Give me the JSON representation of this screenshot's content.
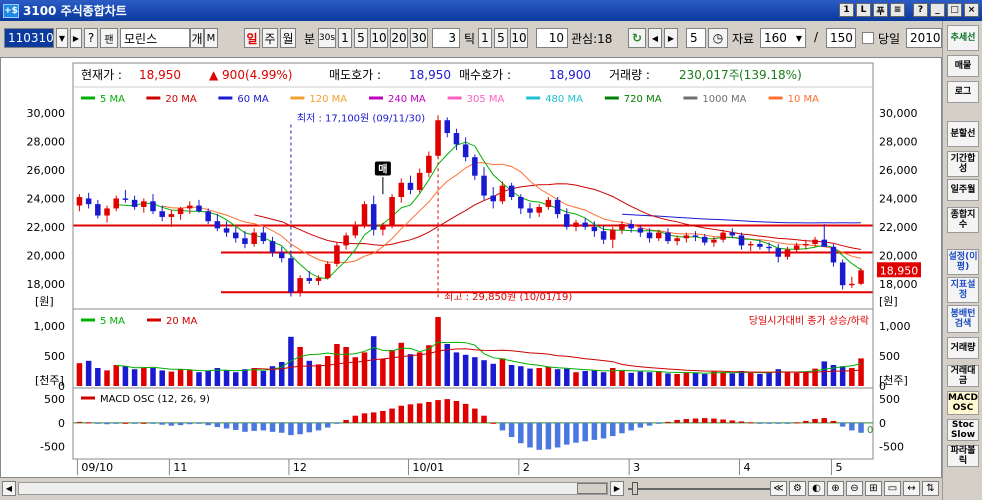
{
  "window": {
    "title": "3100 주식종합차트",
    "icon_label": "+$"
  },
  "title_buttons": [
    "1",
    "L",
    "푸",
    "≡",
    "?",
    "_",
    "□",
    "×"
  ],
  "toolbar": {
    "code": "110310",
    "name": "모린스",
    "period_buttons": [
      "일",
      "주",
      "월"
    ],
    "minute_label": "분",
    "minute_buttons": [
      "30s",
      "1",
      "5",
      "10",
      "20",
      "30"
    ],
    "minute_value": "3",
    "tick_label": "틱",
    "tick_buttons": [
      "1",
      "5",
      "10"
    ],
    "tick_value": "10",
    "watch_label": "관심:18",
    "step_value": "5",
    "data_label": "자료",
    "data_count": "160",
    "slash": "/",
    "total": "150",
    "today_label": "당일",
    "date_value": "2010-",
    "code_btns": [
      "?",
      "팬"
    ],
    "name_btns": [
      "개",
      "M"
    ]
  },
  "right_panel": {
    "items": [
      "추세선",
      "매물",
      "로그",
      "분할선",
      "기간합성",
      "일주월",
      "종합지수",
      "설정(이평)",
      "지표설정",
      "봉배턴검색",
      "거래량",
      "거래대금",
      "MACD OSC",
      "Stoc Slow",
      "파라볼릭"
    ]
  },
  "info": {
    "price_label": "현재가 :",
    "price": "18,950",
    "change": "▲ 900(4.99%)",
    "ask_label": "매도호가 :",
    "ask": "18,950",
    "bid_label": "매수호가 :",
    "bid": "18,900",
    "volume_label": "거래량 :",
    "volume": "230,017주",
    "volume_ratio": "(139.18%)"
  },
  "legend": [
    {
      "label": "5 MA",
      "color": "#00b000"
    },
    {
      "label": "20 MA",
      "color": "#d00000"
    },
    {
      "label": "60 MA",
      "color": "#1a1ad0"
    },
    {
      "label": "120 MA",
      "color": "#f0a030"
    },
    {
      "label": "240 MA",
      "color": "#c000c0"
    },
    {
      "label": "305 MA",
      "color": "#ff60c0"
    },
    {
      "label": "480 MA",
      "color": "#20c0d0"
    },
    {
      "label": "720 MA",
      "color": "#008000"
    },
    {
      "label": "1000 MA",
      "color": "#707070"
    },
    {
      "label": "10 MA",
      "color": "#ff7030"
    }
  ],
  "price_annotations": {
    "low_label": "최저 : 17,100원 (09/11/30)",
    "high_label": "최고 : 29,850원 (10/01/19)",
    "buy_marker": "매",
    "current_price_tag": "18,950",
    "unit_won": "[원]",
    "unit_thousand": "[천주]",
    "volume_legend": [
      {
        "label": "5 MA",
        "color": "#00b000"
      },
      {
        "label": "20 MA",
        "color": "#d00000"
      }
    ],
    "volume_note": "당일시가대비 종가 상승/하락",
    "macd_label": "MACD OSC (12, 26, 9)",
    "macd_zero": "0"
  },
  "axes": {
    "price_ticks": [
      "30,000",
      "28,000",
      "26,000",
      "24,000",
      "22,000",
      "20,000",
      "18,000"
    ],
    "volume_ticks": [
      "1,000",
      "500",
      "0"
    ],
    "macd_ticks": [
      "500",
      "0",
      "-500"
    ],
    "date_ticks": [
      "09/10",
      "11",
      "12",
      "10/01",
      "2",
      "3",
      "4",
      "5"
    ]
  },
  "colors": {
    "up": "#e00000",
    "down": "#1a1ad0",
    "accent": "#2a5cc4"
  },
  "chart_data": {
    "type": "candlestick",
    "title": "",
    "price_range": [
      17000,
      30500
    ],
    "volume_range": [
      0,
      1200
    ],
    "macd_range": [
      -700,
      650
    ],
    "horizontal_lines": [
      22100,
      20200,
      17400
    ],
    "ohlc": [
      [
        23500,
        24300,
        23100,
        24100
      ],
      [
        24000,
        24400,
        23300,
        23600
      ],
      [
        23600,
        23900,
        22600,
        22800
      ],
      [
        22800,
        23500,
        22300,
        23300
      ],
      [
        23300,
        24200,
        23100,
        24000
      ],
      [
        24000,
        24600,
        23700,
        23900
      ],
      [
        23900,
        24200,
        23200,
        23400
      ],
      [
        23400,
        24000,
        23000,
        23800
      ],
      [
        23800,
        24300,
        22900,
        23100
      ],
      [
        23100,
        23500,
        22400,
        22700
      ],
      [
        22700,
        23200,
        22000,
        22900
      ],
      [
        22900,
        23400,
        22500,
        23300
      ],
      [
        23300,
        23800,
        22900,
        23500
      ],
      [
        23500,
        23900,
        23000,
        23100
      ],
      [
        23100,
        23300,
        22200,
        22400
      ],
      [
        22400,
        22900,
        21700,
        21900
      ],
      [
        21900,
        22400,
        21300,
        21600
      ],
      [
        21600,
        22000,
        20900,
        21200
      ],
      [
        21200,
        21700,
        20500,
        20800
      ],
      [
        20800,
        21900,
        20600,
        21600
      ],
      [
        21600,
        22000,
        20800,
        21000
      ],
      [
        21000,
        21300,
        19900,
        20200
      ],
      [
        20200,
        20600,
        19500,
        19800
      ],
      [
        19800,
        20100,
        17100,
        17400
      ],
      [
        17400,
        18600,
        17100,
        18400
      ],
      [
        18400,
        18900,
        18000,
        18200
      ],
      [
        18200,
        18600,
        17900,
        18400
      ],
      [
        18400,
        19600,
        18300,
        19400
      ],
      [
        19400,
        20900,
        19200,
        20700
      ],
      [
        20700,
        21600,
        20400,
        21400
      ],
      [
        21400,
        22400,
        21200,
        22100
      ],
      [
        22100,
        23800,
        21900,
        23600
      ],
      [
        23600,
        24200,
        21400,
        21800
      ],
      [
        21800,
        22300,
        21400,
        22100
      ],
      [
        22100,
        24300,
        21900,
        24100
      ],
      [
        24100,
        25400,
        23700,
        25100
      ],
      [
        25100,
        25600,
        24300,
        24600
      ],
      [
        24600,
        26100,
        24400,
        25800
      ],
      [
        25800,
        27300,
        25500,
        27000
      ],
      [
        27000,
        29850,
        26800,
        29500
      ],
      [
        29500,
        29700,
        28300,
        28600
      ],
      [
        28600,
        28900,
        27400,
        27800
      ],
      [
        27800,
        28300,
        26600,
        26900
      ],
      [
        26900,
        27100,
        25300,
        25600
      ],
      [
        25600,
        26200,
        23900,
        24200
      ],
      [
        24200,
        24800,
        23300,
        23800
      ],
      [
        23800,
        25200,
        23600,
        24900
      ],
      [
        24900,
        25100,
        23900,
        24100
      ],
      [
        24100,
        24300,
        22900,
        23300
      ],
      [
        23300,
        23700,
        22600,
        23000
      ],
      [
        23000,
        23600,
        22700,
        23400
      ],
      [
        23400,
        24100,
        23200,
        23900
      ],
      [
        23900,
        24100,
        22600,
        22900
      ],
      [
        22900,
        23300,
        21800,
        22000
      ],
      [
        22000,
        22500,
        21700,
        22300
      ],
      [
        22300,
        22600,
        21800,
        22000
      ],
      [
        22000,
        22400,
        21300,
        21700
      ],
      [
        21700,
        22100,
        20800,
        21100
      ],
      [
        21100,
        22000,
        20500,
        21800
      ],
      [
        21800,
        22400,
        21500,
        22200
      ],
      [
        22200,
        22500,
        21600,
        21900
      ],
      [
        21900,
        22100,
        21300,
        21600
      ],
      [
        21600,
        21900,
        20900,
        21200
      ],
      [
        21200,
        21800,
        21000,
        21600
      ],
      [
        21600,
        21900,
        20800,
        21000
      ],
      [
        21000,
        21400,
        20700,
        21200
      ],
      [
        21200,
        21600,
        20900,
        21400
      ],
      [
        21400,
        21700,
        21000,
        21300
      ],
      [
        21300,
        21500,
        20700,
        20900
      ],
      [
        20900,
        21300,
        20600,
        21100
      ],
      [
        21100,
        21800,
        20900,
        21600
      ],
      [
        21600,
        21900,
        21200,
        21400
      ],
      [
        21400,
        21600,
        20400,
        20700
      ],
      [
        20700,
        21000,
        20300,
        20800
      ],
      [
        20800,
        21100,
        20400,
        20600
      ],
      [
        20600,
        20900,
        20200,
        20500
      ],
      [
        20500,
        20800,
        19500,
        19900
      ],
      [
        19900,
        20600,
        19700,
        20400
      ],
      [
        20400,
        20900,
        20200,
        20700
      ],
      [
        20700,
        21100,
        20400,
        20800
      ],
      [
        20800,
        21300,
        20600,
        21100
      ],
      [
        21100,
        22200,
        20900,
        20600
      ],
      [
        20600,
        20800,
        19200,
        19500
      ],
      [
        19500,
        19700,
        17600,
        17900
      ],
      [
        17900,
        18500,
        17700,
        18000
      ],
      [
        18000,
        19100,
        17900,
        18950
      ]
    ],
    "volume": [
      380,
      420,
      300,
      260,
      350,
      330,
      280,
      310,
      300,
      260,
      240,
      280,
      270,
      230,
      250,
      300,
      260,
      230,
      280,
      300,
      250,
      330,
      400,
      820,
      650,
      420,
      360,
      500,
      700,
      650,
      480,
      560,
      830,
      450,
      600,
      720,
      530,
      560,
      680,
      1150,
      700,
      560,
      520,
      480,
      430,
      370,
      460,
      350,
      330,
      290,
      300,
      320,
      280,
      290,
      230,
      250,
      260,
      230,
      300,
      260,
      220,
      240,
      230,
      250,
      210,
      200,
      230,
      220,
      200,
      240,
      230,
      210,
      250,
      220,
      200,
      230,
      280,
      240,
      220,
      230,
      290,
      410,
      350,
      330,
      300,
      460
    ],
    "macd": [
      20,
      10,
      -20,
      -30,
      -10,
      0,
      -10,
      0,
      -20,
      -40,
      -60,
      -50,
      -30,
      -20,
      -50,
      -90,
      -120,
      -150,
      -190,
      -170,
      -160,
      -190,
      -210,
      -260,
      -240,
      -200,
      -160,
      -100,
      -20,
      60,
      150,
      200,
      220,
      250,
      300,
      360,
      390,
      410,
      440,
      480,
      500,
      460,
      400,
      300,
      150,
      0,
      -160,
      -300,
      -430,
      -520,
      -570,
      -560,
      -520,
      -460,
      -420,
      -390,
      -360,
      -330,
      -280,
      -220,
      -160,
      -100,
      -60,
      -20,
      20,
      60,
      80,
      90,
      100,
      90,
      70,
      50,
      30,
      10,
      -10,
      -20,
      -20,
      -10,
      10,
      40,
      80,
      100,
      40,
      -80,
      -160,
      -210
    ],
    "x_dates": [
      "09/10",
      "11",
      "12",
      "10/01",
      "2",
      "3",
      "4",
      "5"
    ],
    "series": [
      {
        "name": "5 MA",
        "values": []
      },
      {
        "name": "20 MA",
        "values": []
      },
      {
        "name": "60 MA",
        "values": []
      }
    ]
  }
}
